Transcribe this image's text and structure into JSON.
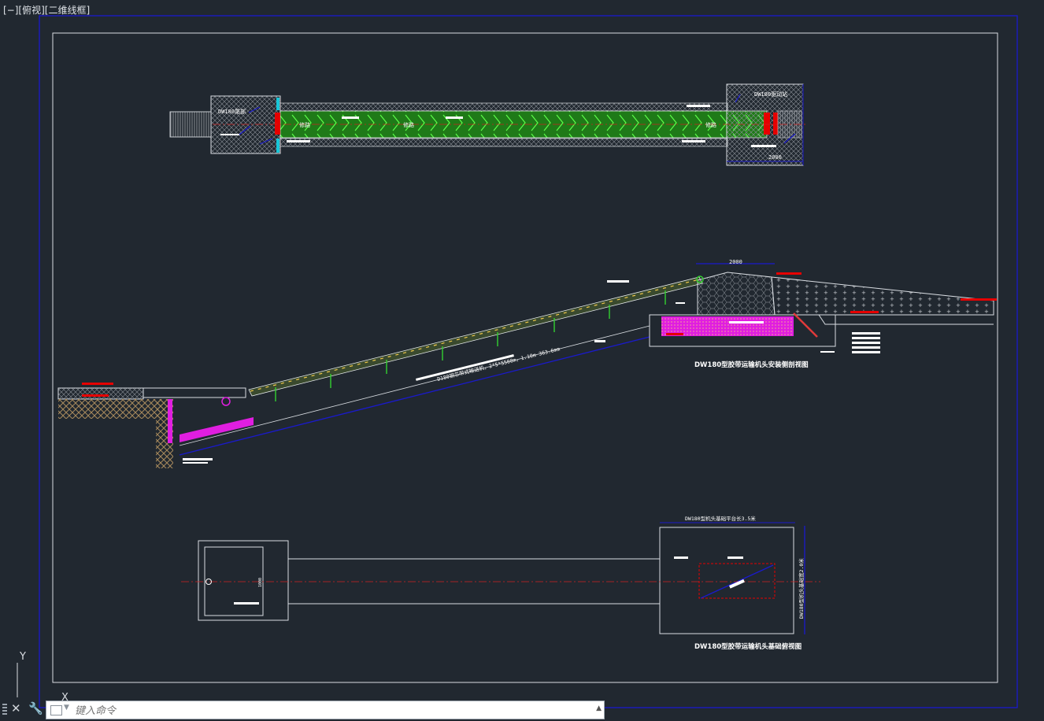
{
  "viewport": {
    "label": "[−][俯视][二维线框]"
  },
  "command_line": {
    "placeholder": "键入命令"
  },
  "ucs": {
    "y_label": "Y",
    "x_label": "X"
  },
  "plan_view": {
    "tail_label": "DW180尾部",
    "head_label": "DW180驱动站",
    "walkway_labels": [
      "修路",
      "修路",
      "修路"
    ],
    "dimension": "2000"
  },
  "elevation_view": {
    "head_dimension": "2000",
    "slope_note": "D180钢芯带式输送机，2*5*5500m，1.10m 363.6mm",
    "title": "DW180型胶带运输机头安装侧剖视图"
  },
  "foundation_plan": {
    "top_note": "DW180型机头基础平台长3.5米",
    "side_note": "DW180型机头基础宽2.0米",
    "small_dim": "1000",
    "title": "DW180型胶带运输机头基础俯视图"
  },
  "colors": {
    "background": "#212830",
    "frame_blue": "#1a1acc",
    "belt_green": "#22a11c",
    "magenta": "#e01ee0",
    "red": "#e60000",
    "cyan": "#18c7d8",
    "centerline": "#d02020"
  }
}
